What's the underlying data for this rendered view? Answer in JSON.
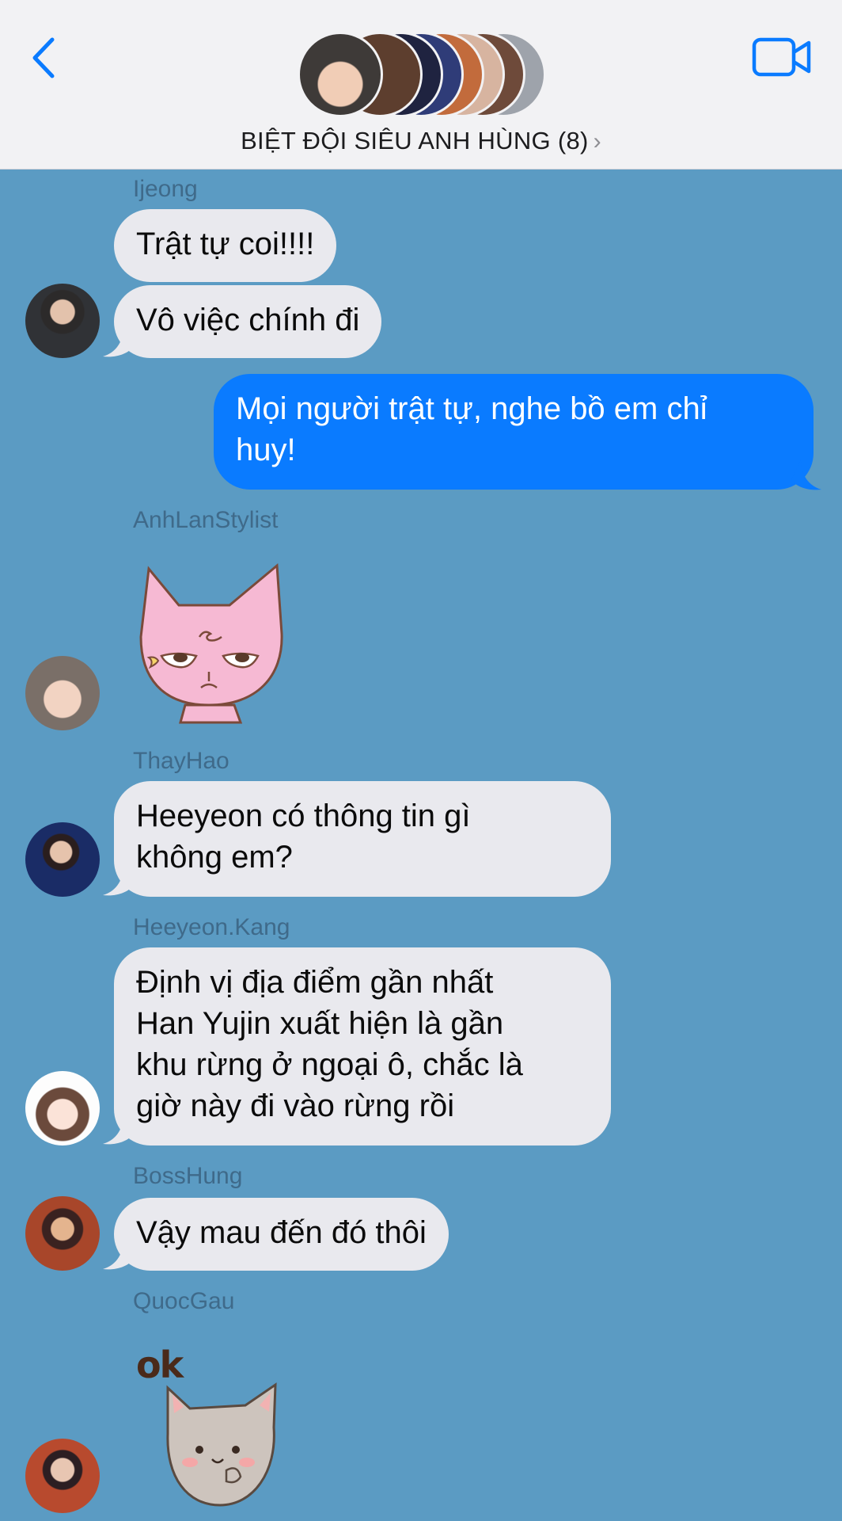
{
  "header": {
    "back_icon": "chevron-left-icon",
    "video_icon": "video-camera-icon",
    "title": "BIỆT ĐỘI SIÊU ANH HÙNG (8)",
    "title_chevron": "›",
    "accent_color": "#0a7bff"
  },
  "messages": [
    {
      "sender": "Ijeong",
      "texts": [
        "Trật tự coi!!!!",
        "Vô việc chính đi"
      ]
    },
    {
      "outgoing": true,
      "text_line1": "Mọi người trật tự, nghe bồ em chỉ",
      "text_line2": "huy!"
    },
    {
      "sender": "AnhLanStylist",
      "sticker": "pink-cat-sticker"
    },
    {
      "sender": "ThayHao",
      "text_line1": "Heeyeon có thông tin gì",
      "text_line2": "không em?"
    },
    {
      "sender": "Heeyeon.Kang",
      "lines": [
        "Định vị địa điểm gần nhất",
        "Han Yujin xuất hiện là gần",
        "khu rừng ở ngoại ô, chắc là",
        "giờ này đi vào rừng rồi"
      ]
    },
    {
      "sender": "BossHung",
      "text": "Vậy mau đến đó thôi"
    },
    {
      "sender": "QuocGau",
      "sticker": "ok-cat-sticker",
      "sticker_text": "ok"
    }
  ],
  "colors": {
    "background": "#5b9bc3",
    "incoming_bubble": "#e9e9ee",
    "outgoing_bubble": "#0a7bff"
  }
}
